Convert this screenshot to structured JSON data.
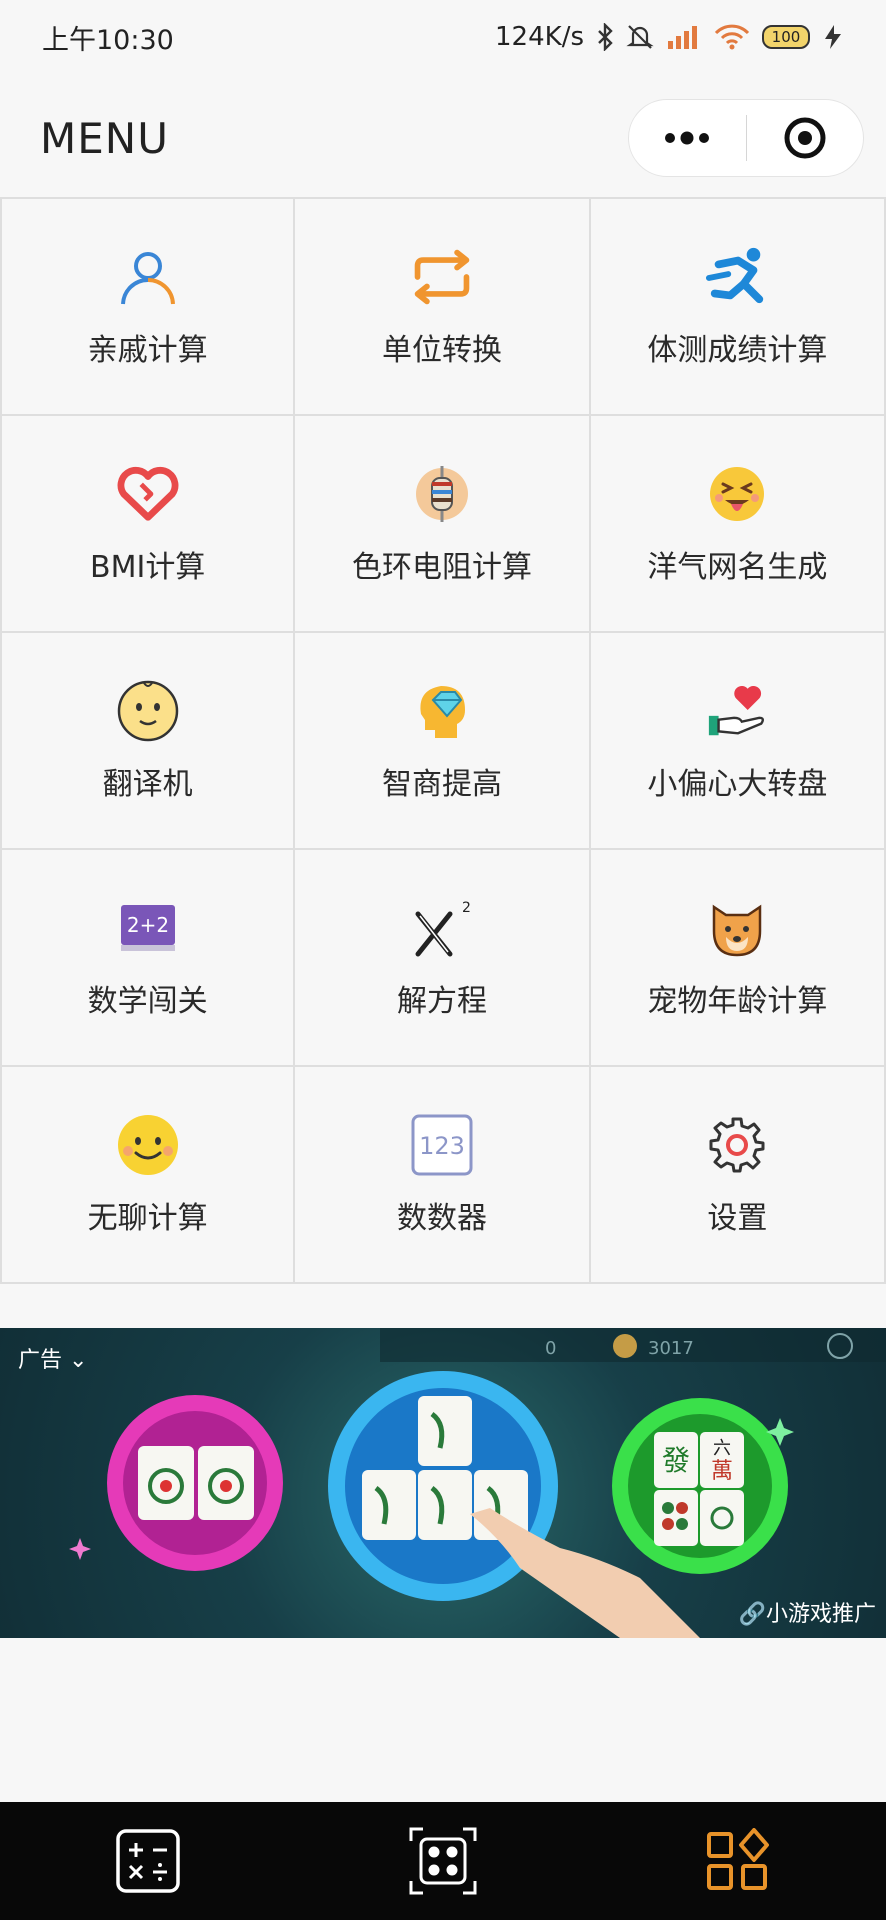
{
  "status": {
    "time": "上午10:30",
    "speed": "124K/s",
    "battery": "100"
  },
  "nav": {
    "title": "MENU"
  },
  "menu_items": [
    {
      "label": "亲戚计算",
      "icon": "person-icon"
    },
    {
      "label": "单位转换",
      "icon": "convert-icon"
    },
    {
      "label": "体测成绩计算",
      "icon": "runner-icon"
    },
    {
      "label": "BMI计算",
      "icon": "heart-icon"
    },
    {
      "label": "色环电阻计算",
      "icon": "resistor-icon"
    },
    {
      "label": "洋气网名生成",
      "icon": "tongue-emoji-icon"
    },
    {
      "label": "翻译机",
      "icon": "smiley-icon"
    },
    {
      "label": "智商提高",
      "icon": "brain-diamond-icon"
    },
    {
      "label": "小偏心大转盘",
      "icon": "hand-heart-icon"
    },
    {
      "label": "数学闯关",
      "icon": "math-board-icon"
    },
    {
      "label": "解方程",
      "icon": "x-squared-icon"
    },
    {
      "label": "宠物年龄计算",
      "icon": "dog-icon"
    },
    {
      "label": "无聊计算",
      "icon": "happy-face-icon"
    },
    {
      "label": "数数器",
      "icon": "counter-123-icon"
    },
    {
      "label": "设置",
      "icon": "gear-icon"
    }
  ],
  "ad": {
    "tag": "广告",
    "promo": "小游戏推广",
    "counter_1": "0",
    "counter_2": "3017",
    "tile_text_1": "發",
    "tile_text_2": "六",
    "tile_text_3": "萬"
  },
  "tabbar": {
    "items": [
      "calculator-tab-icon",
      "dice-tab-icon",
      "apps-tab-icon"
    ],
    "active_color": "#e8932a"
  },
  "colors": {
    "accent_orange": "#f0952f",
    "blue": "#3a86d6",
    "red": "#e84a4a"
  }
}
